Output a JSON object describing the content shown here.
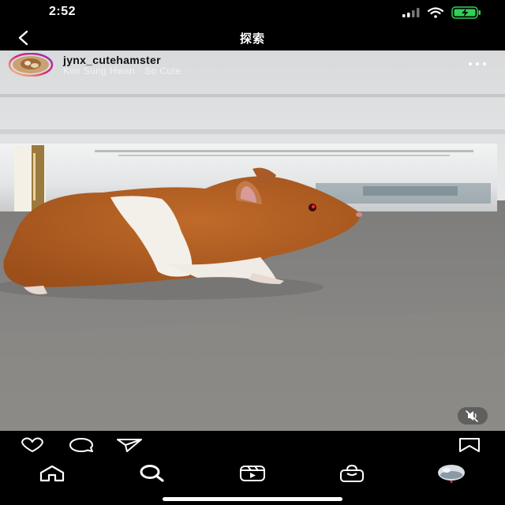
{
  "status_bar": {
    "time": "2:52",
    "icons": [
      "cellular-signal-icon",
      "wifi-icon",
      "battery-charging-icon"
    ],
    "battery_color": "#30d158"
  },
  "nav": {
    "title": "探索",
    "back_icon": "chevron-left-icon"
  },
  "post": {
    "username": "jynx_cutehamster",
    "subtitle": "Kim Sung Hwan · So Cute",
    "avatar_ring_colors": [
      "#feda75",
      "#d62976",
      "#962fbf"
    ],
    "media_description_icon": "video",
    "more_icon": "more-horizontal-icon",
    "mute_icon": "speaker-muted-icon"
  },
  "actions": {
    "icons": [
      "heart-icon",
      "comment-icon",
      "share-icon",
      "bookmark-icon"
    ]
  },
  "tabs": {
    "items": [
      "home-icon",
      "search-icon",
      "reels-icon",
      "shop-icon",
      "profile-avatar"
    ],
    "active": "search-icon"
  }
}
